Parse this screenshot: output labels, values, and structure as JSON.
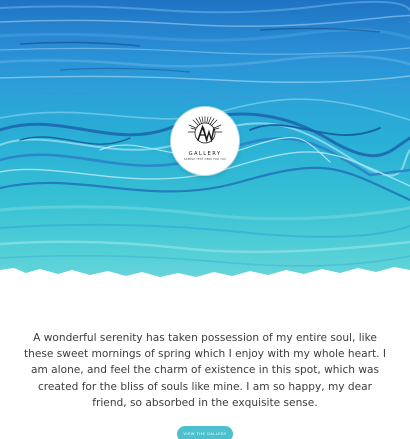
{
  "brand": {
    "name": "GALLERY",
    "tagline": "SAMPLE TEXT HERE FOR YOU"
  },
  "intro": {
    "text": "A wonderful serenity has taken possession of my entire soul, like these sweet mornings of spring which I enjoy with my whole heart. I am alone, and feel the charm of existence in this spot, which was created for the bliss of souls like mine. I am so happy, my dear friend, so absorbed in the exquisite sense."
  },
  "cta": {
    "label": "VIEW THE GALLERY"
  },
  "colors": {
    "hero_top": "#1f73c2",
    "hero_bottom": "#6ad6db",
    "button": "#4cc0cf",
    "text": "#3c3c3c"
  },
  "icons": {
    "logo": "aw-monogram-logo"
  }
}
